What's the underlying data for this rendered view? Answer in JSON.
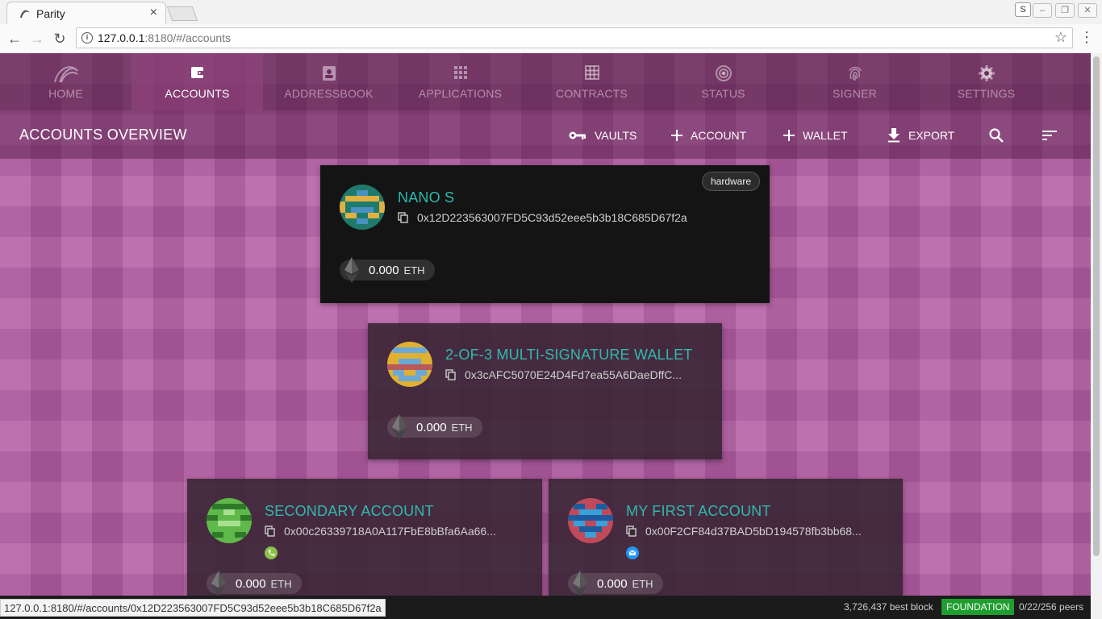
{
  "browser": {
    "tab_title": "Parity",
    "tab_close": "×",
    "url_host": "127.0.0.1",
    "url_rest": ":8180/#/accounts",
    "ext_label": "S"
  },
  "nav": {
    "items": [
      {
        "label": "HOME",
        "icon": "parity-logo-icon"
      },
      {
        "label": "ACCOUNTS",
        "icon": "wallet-icon"
      },
      {
        "label": "ADDRESSBOOK",
        "icon": "contact-icon"
      },
      {
        "label": "APPLICATIONS",
        "icon": "apps-grid-icon"
      },
      {
        "label": "CONTRACTS",
        "icon": "grid-icon"
      },
      {
        "label": "STATUS",
        "icon": "signal-icon"
      },
      {
        "label": "SIGNER",
        "icon": "fingerprint-icon"
      },
      {
        "label": "SETTINGS",
        "icon": "gear-icon"
      }
    ],
    "active": "ACCOUNTS"
  },
  "toolbar": {
    "title": "ACCOUNTS OVERVIEW",
    "vaults": "VAULTS",
    "account": "ACCOUNT",
    "wallet": "WALLET",
    "export": "EXPORT"
  },
  "accounts": [
    {
      "name": "NANO S",
      "address": "0x12D223563007FD5C93d52eee5b3b18C685D67f2a",
      "balance": "0.000",
      "unit": "ETH",
      "badge": "hardware"
    },
    {
      "name": "2-OF-3 MULTI-SIGNATURE WALLET",
      "address": "0x3cAFC5070E24D4Fd7ea55A6DaeDffC...",
      "balance": "0.000",
      "unit": "ETH"
    },
    {
      "name": "SECONDARY ACCOUNT",
      "address": "0x00c26339718A0A117FbE8bBfa6Aa66...",
      "balance": "0.000",
      "unit": "ETH"
    },
    {
      "name": "MY FIRST ACCOUNT",
      "address": "0x00F2CF84d37BAD5bD194578fb3bb68...",
      "balance": "0.000",
      "unit": "ETH"
    }
  ],
  "status": {
    "url_hint": "127.0.0.1:8180/#/accounts/0x12D223563007FD5C93d52eee5b3b18C685D67f2a",
    "block": "3,726,437 best block",
    "chain": "FOUNDATION",
    "peers": "0/22/256 peers"
  },
  "colors": {
    "accent": "#2fb9ad",
    "chain_badge": "#1e9e2e",
    "background": "#b35ca3"
  }
}
